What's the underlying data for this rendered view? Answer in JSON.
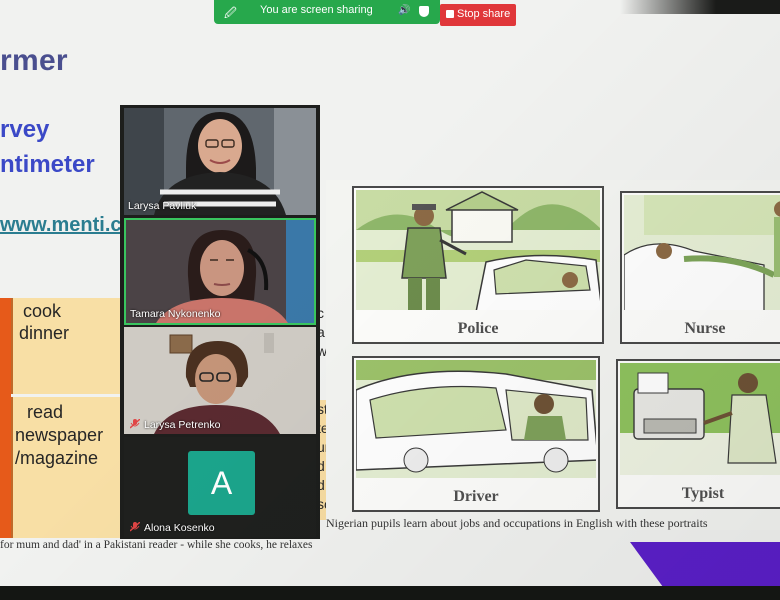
{
  "zoom_bar": {
    "sharing_text": "You are screen sharing",
    "stop_label": "Stop share"
  },
  "slide": {
    "heading_fragment": "rmer",
    "subtitle_line1": "rvey",
    "subtitle_line2": "ntimeter",
    "link_text": "www.menti.co"
  },
  "vocab": {
    "row1": [
      "cook",
      "dinner"
    ],
    "row2": [
      "read",
      "newspaper",
      "/magazine"
    ]
  },
  "peek_letters": {
    "top": "c\na\nw",
    "bottom": "st\nte\nur\nd\nd\nsc"
  },
  "pictures": [
    {
      "caption": "Police"
    },
    {
      "caption": "Nurse"
    },
    {
      "caption": "Driver"
    },
    {
      "caption": "Typist"
    }
  ],
  "panel_caption": "Nigerian pupils learn about jobs and occupations in English with these portraits",
  "bottom_caption": "for mum and dad' in a Pakistani reader - while she cooks, he relaxes",
  "participants": [
    {
      "name": "Larysa Pavliuk",
      "muted": false
    },
    {
      "name": "Tamara Nykonenko",
      "muted": false
    },
    {
      "name": "Larysa Petrenko",
      "muted": true
    },
    {
      "name": "Alona Kosenko",
      "muted": true,
      "avatar_letter": "A"
    }
  ],
  "colors": {
    "share_bar": "#27a84c",
    "stop_button": "#e0373a",
    "heading": "#4a4f8f",
    "subtitle": "#3b49c7",
    "table_cell": "#f8dfa5",
    "table_bar": "#e65a1a",
    "active_speaker_border": "#39c55f",
    "avatar": "#1ba58c",
    "accent_purple": "#5b1fc9"
  },
  "icons": {
    "share": "screen-share-icon",
    "speaker": "speaker-icon",
    "shield": "shield-icon",
    "stop": "stop-icon",
    "mute": "muted-mic-icon"
  }
}
